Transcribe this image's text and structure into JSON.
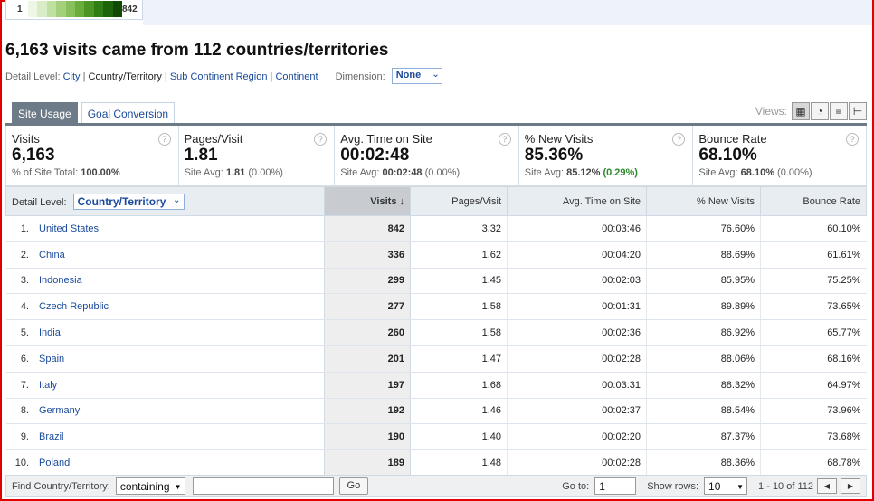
{
  "scale": {
    "low": "1",
    "high": "842",
    "colors": [
      "#eef6e6",
      "#d8edc6",
      "#c0e0a2",
      "#a4d07c",
      "#88c05c",
      "#6aad3c",
      "#4c9626",
      "#327e16",
      "#1e640c",
      "#104a04"
    ]
  },
  "title": "6,163 visits came from 112 countries/territories",
  "detail_level": {
    "label": "Detail Level:",
    "links": [
      {
        "text": "City",
        "current": false
      },
      {
        "text": "Country/Territory",
        "current": true
      },
      {
        "text": "Sub Continent Region",
        "current": false
      },
      {
        "text": "Continent",
        "current": false
      }
    ],
    "dimension_label": "Dimension:",
    "dimension_value": "None"
  },
  "tabs": [
    {
      "label": "Site Usage",
      "active": true
    },
    {
      "label": "Goal Conversion",
      "active": false
    }
  ],
  "views_label": "Views:",
  "view_icons": [
    "table-view-icon",
    "pie-view-icon",
    "bar-view-icon",
    "pivot-view-icon"
  ],
  "metrics": [
    {
      "name": "Visits",
      "value": "6,163",
      "sub_label": "% of Site Total:",
      "sub_value": "100.00%",
      "sub_change": ""
    },
    {
      "name": "Pages/Visit",
      "value": "1.81",
      "sub_label": "Site Avg:",
      "sub_value": "1.81",
      "sub_change": "(0.00%)"
    },
    {
      "name": "Avg. Time on Site",
      "value": "00:02:48",
      "sub_label": "Site Avg:",
      "sub_value": "00:02:48",
      "sub_change": "(0.00%)"
    },
    {
      "name": "% New Visits",
      "value": "85.36%",
      "sub_label": "Site Avg:",
      "sub_value": "85.12%",
      "sub_change": "(0.29%)"
    },
    {
      "name": "Bounce Rate",
      "value": "68.10%",
      "sub_label": "Site Avg:",
      "sub_value": "68.10%",
      "sub_change": "(0.00%)"
    }
  ],
  "table": {
    "detail_label": "Detail Level:",
    "detail_value": "Country/Territory",
    "columns": [
      "Visits",
      "Pages/Visit",
      "Avg. Time on Site",
      "% New Visits",
      "Bounce Rate"
    ],
    "sort_arrow": "↓",
    "rows": [
      {
        "num": "1.",
        "name": "United States",
        "visits": "842",
        "ppv": "3.32",
        "time": "00:03:46",
        "newv": "76.60%",
        "bounce": "60.10%"
      },
      {
        "num": "2.",
        "name": "China",
        "visits": "336",
        "ppv": "1.62",
        "time": "00:04:20",
        "newv": "88.69%",
        "bounce": "61.61%"
      },
      {
        "num": "3.",
        "name": "Indonesia",
        "visits": "299",
        "ppv": "1.45",
        "time": "00:02:03",
        "newv": "85.95%",
        "bounce": "75.25%"
      },
      {
        "num": "4.",
        "name": "Czech Republic",
        "visits": "277",
        "ppv": "1.58",
        "time": "00:01:31",
        "newv": "89.89%",
        "bounce": "73.65%"
      },
      {
        "num": "5.",
        "name": "India",
        "visits": "260",
        "ppv": "1.58",
        "time": "00:02:36",
        "newv": "86.92%",
        "bounce": "65.77%"
      },
      {
        "num": "6.",
        "name": "Spain",
        "visits": "201",
        "ppv": "1.47",
        "time": "00:02:28",
        "newv": "88.06%",
        "bounce": "68.16%"
      },
      {
        "num": "7.",
        "name": "Italy",
        "visits": "197",
        "ppv": "1.68",
        "time": "00:03:31",
        "newv": "88.32%",
        "bounce": "64.97%"
      },
      {
        "num": "8.",
        "name": "Germany",
        "visits": "192",
        "ppv": "1.46",
        "time": "00:02:37",
        "newv": "88.54%",
        "bounce": "73.96%"
      },
      {
        "num": "9.",
        "name": "Brazil",
        "visits": "190",
        "ppv": "1.40",
        "time": "00:02:20",
        "newv": "87.37%",
        "bounce": "73.68%"
      },
      {
        "num": "10.",
        "name": "Poland",
        "visits": "189",
        "ppv": "1.48",
        "time": "00:02:28",
        "newv": "88.36%",
        "bounce": "68.78%"
      }
    ]
  },
  "footer": {
    "find_label": "Find Country/Territory:",
    "filter_mode": "containing",
    "find_value": "",
    "go_button": "Go",
    "goto_label": "Go to:",
    "goto_value": "1",
    "rows_label": "Show rows:",
    "rows_value": "10",
    "range": "1 - 10 of 112"
  }
}
